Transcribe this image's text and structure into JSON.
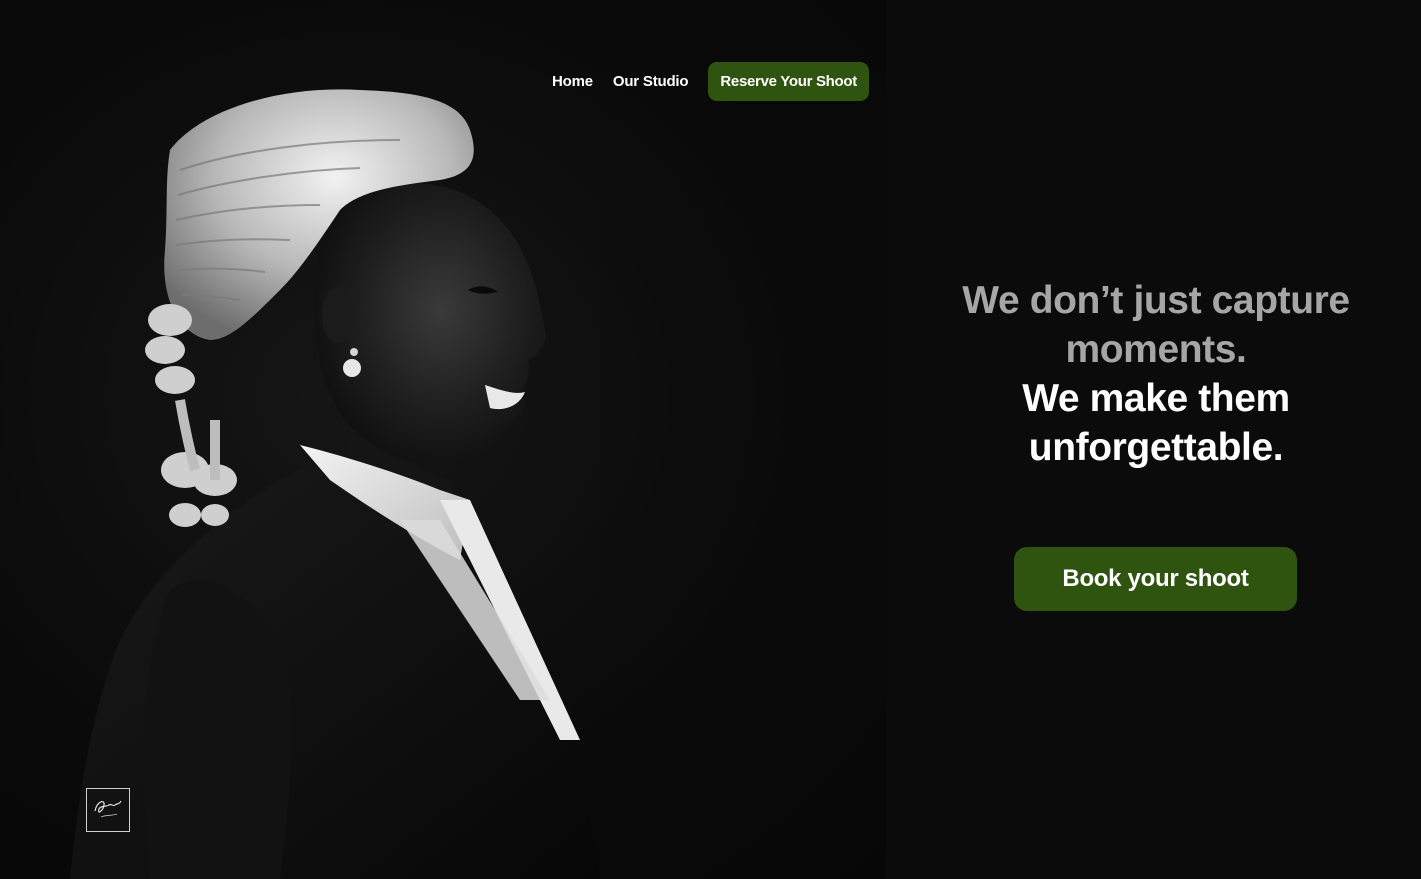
{
  "nav": {
    "items": [
      {
        "label": "Home"
      },
      {
        "label": "Our Studio"
      }
    ],
    "cta_label": "Reserve Your Shoot"
  },
  "hero": {
    "headline_line1": "We don’t just capture moments.",
    "headline_line2": "We make them unforgettable.",
    "button_label": "Book your shoot",
    "image_subject": "portrait of a smiling barrister in a white wig and black gown (black and white photo)"
  },
  "logo": {
    "icon": "signature-logo-icon"
  },
  "colors": {
    "background": "#0b0b0b",
    "accent_green": "#2e5410",
    "muted_text": "#a6a6a6",
    "text": "#ffffff"
  }
}
